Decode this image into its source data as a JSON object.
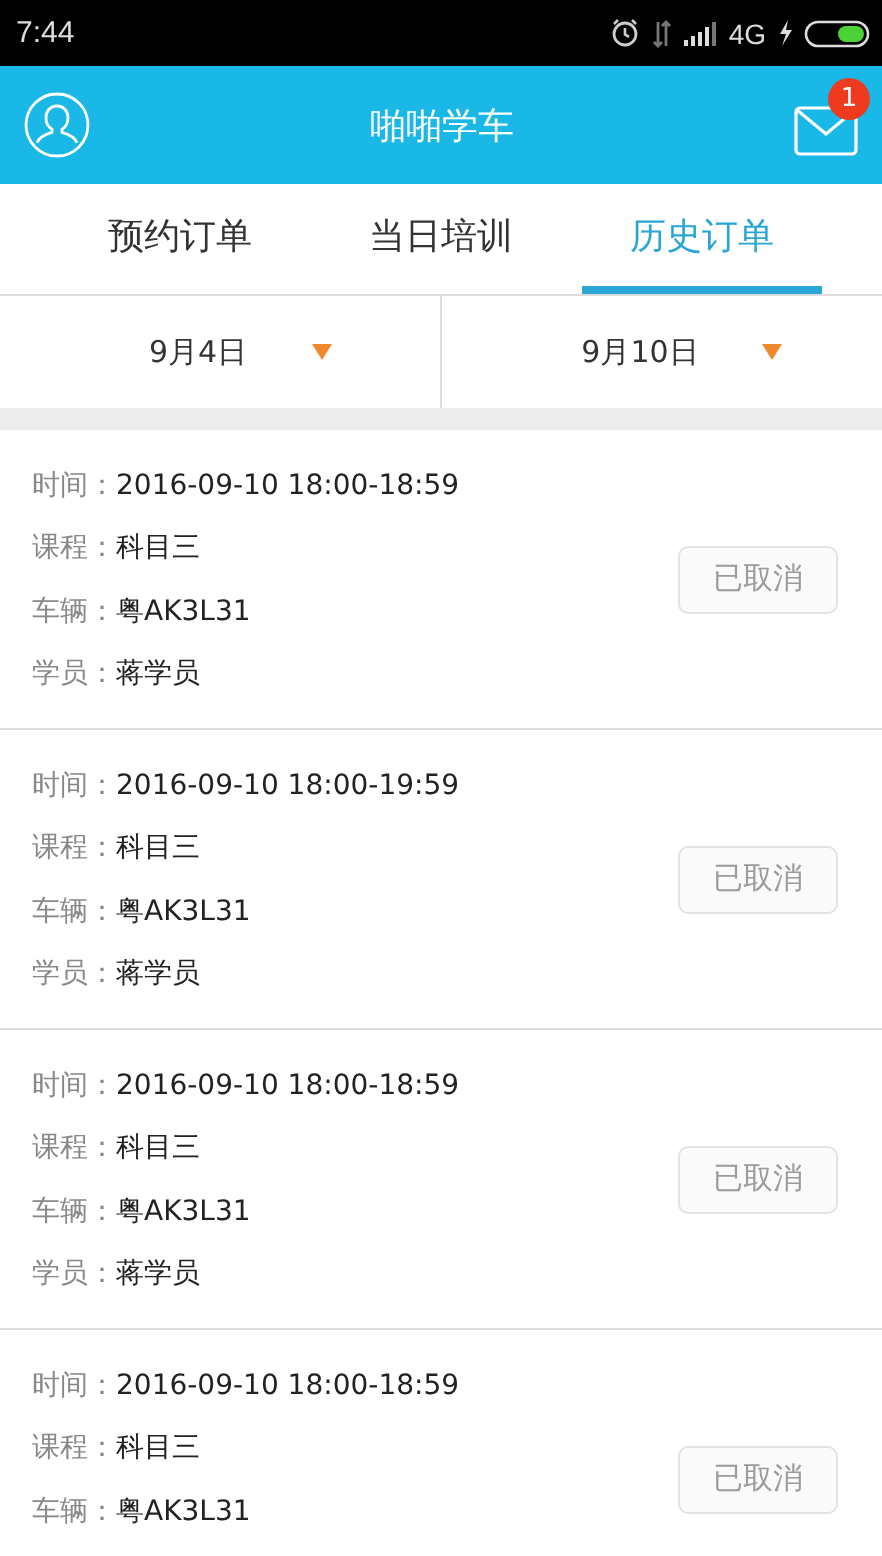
{
  "status_bar": {
    "time": "7:44",
    "network": "4G"
  },
  "header": {
    "title": "啪啪学车",
    "badge": "1"
  },
  "tabs": [
    {
      "label": "预约订单",
      "selected": false
    },
    {
      "label": "当日培训",
      "selected": false
    },
    {
      "label": "历史订单",
      "selected": true
    }
  ],
  "date_filters": [
    {
      "label": "9月4日"
    },
    {
      "label": "9月10日"
    }
  ],
  "orders": [
    {
      "fields": [
        {
          "label": "时间：",
          "value": "2016-09-10 18:00-18:59"
        },
        {
          "label": "课程：",
          "value": "科目三"
        },
        {
          "label": "车辆：",
          "value": "粤AK3L31"
        },
        {
          "label": "学员：",
          "value": "蒋学员"
        }
      ],
      "button": {
        "label": "已取消",
        "disabled": true
      }
    },
    {
      "fields": [
        {
          "label": "时间：",
          "value": "2016-09-10 18:00-19:59"
        },
        {
          "label": "课程：",
          "value": "科目三"
        },
        {
          "label": "车辆：",
          "value": "粤AK3L31"
        },
        {
          "label": "学员：",
          "value": "蒋学员"
        }
      ],
      "button": {
        "label": "已取消",
        "disabled": true
      }
    },
    {
      "fields": [
        {
          "label": "时间：",
          "value": "2016-09-10 18:00-18:59"
        },
        {
          "label": "课程：",
          "value": "科目三"
        },
        {
          "label": "车辆：",
          "value": "粤AK3L31"
        },
        {
          "label": "学员：",
          "value": "蒋学员"
        }
      ],
      "button": {
        "label": "已取消",
        "disabled": true
      }
    },
    {
      "fields": [
        {
          "label": "时间：",
          "value": "2016-09-10 18:00-18:59"
        },
        {
          "label": "课程：",
          "value": "科目三"
        },
        {
          "label": "车辆：",
          "value": "粤AK3L31"
        }
      ],
      "button": {
        "label": "已取消",
        "disabled": true
      }
    }
  ]
}
